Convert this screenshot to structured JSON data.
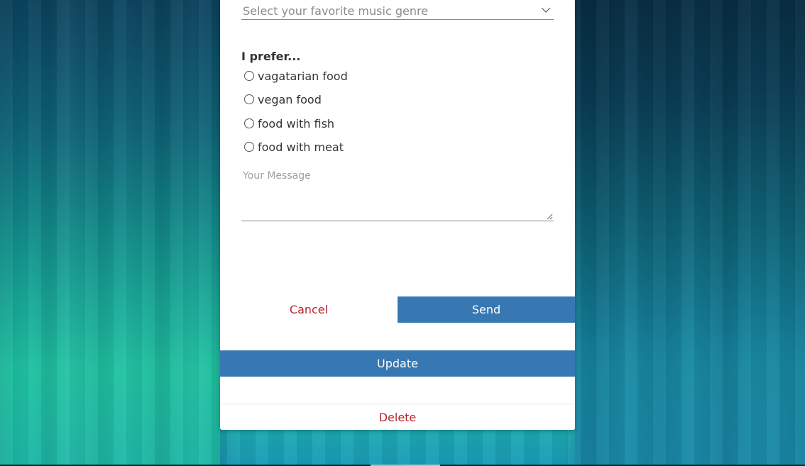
{
  "form": {
    "genre_select": {
      "placeholder": "Select your favorite music genre"
    },
    "preference": {
      "label": "I prefer...",
      "options": [
        "vagatarian food",
        "vegan food",
        "food with fish",
        "food with meat"
      ]
    },
    "message": {
      "placeholder": "Your Message"
    }
  },
  "actions": {
    "cancel_label": "Cancel",
    "send_label": "Send",
    "update_label": "Update",
    "delete_label": "Delete"
  },
  "colors": {
    "primary": "#3778b3",
    "danger": "#b8262b",
    "panel_bg": "#ffffff"
  }
}
